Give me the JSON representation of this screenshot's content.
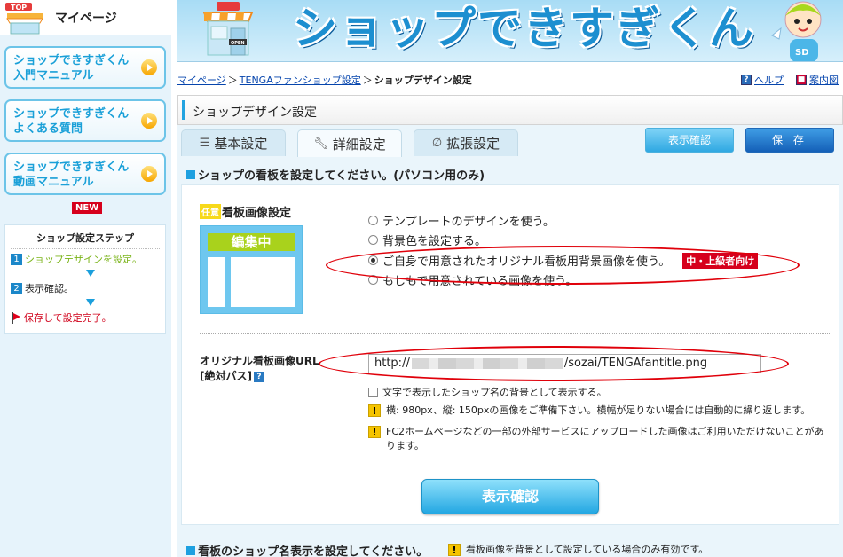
{
  "sidebar": {
    "mypage_title": "マイページ",
    "links": [
      {
        "line1": "ショップできすぎくん",
        "line2": "入門マニュアル"
      },
      {
        "line1": "ショップできすぎくん",
        "line2": "よくある質問"
      },
      {
        "line1": "ショップできすぎくん",
        "line2": "動画マニュアル"
      }
    ],
    "new_badge": "NEW",
    "steps": {
      "title": "ショップ設定ステップ",
      "items": [
        {
          "num": "1",
          "label": "ショップデザインを設定。"
        },
        {
          "num": "2",
          "label": "表示確認。"
        },
        {
          "label": "保存して設定完了。"
        }
      ]
    }
  },
  "banner": {
    "title": "ショップできすぎくん"
  },
  "breadcrumb": {
    "items": [
      "マイページ",
      "TENGAファンショップ設定"
    ],
    "separator": "＞",
    "current": "ショップデザイン設定",
    "help": "ヘルプ",
    "guide": "案内図"
  },
  "panel": {
    "title": "ショップデザイン設定",
    "tabs": [
      "基本設定",
      "詳細設定",
      "拡張設定"
    ],
    "preview_button": "表示確認",
    "save_button": "保 存",
    "section_heading": "ショップの看板を設定してください。(パソコン用のみ)",
    "image_setting": {
      "optional_badge": "任意",
      "title": "看板画像設定",
      "preview_head": "編集中",
      "options": [
        "テンプレートのデザインを使う。",
        "背景色を設定する。",
        "ご自身で用意されたオリジナル看板用背景画像を使う。",
        "もしもで用意されている画像を使う。"
      ],
      "selected_index": 2,
      "level_badge": "中・上級者向け"
    },
    "url_setting": {
      "label_line1": "オリジナル看板画像URL",
      "label_line2": "[絶対パス]",
      "value_prefix": "http://",
      "value_suffix": "/sozai/TENGAfantitle.png",
      "checkbox_label": "文字で表示したショップ名の背景として表示する。",
      "warning1": "横: 980px、縦: 150pxの画像をご準備下さい。横幅が足りない場合には自動的に繰り返します。",
      "warning2": "FC2ホームページなどの一部の外部サービスにアップロードした画像はご利用いただけないことがあります。"
    },
    "main_preview_button": "表示確認",
    "section_heading2": "看板のショップ名表示を設定してください。",
    "section_note2": "看板画像を背景として設定している場合のみ有効です。"
  },
  "colors": {
    "accent": "#1da0e0",
    "highlight": "#e0000a",
    "badge_red": "#d6001c"
  }
}
